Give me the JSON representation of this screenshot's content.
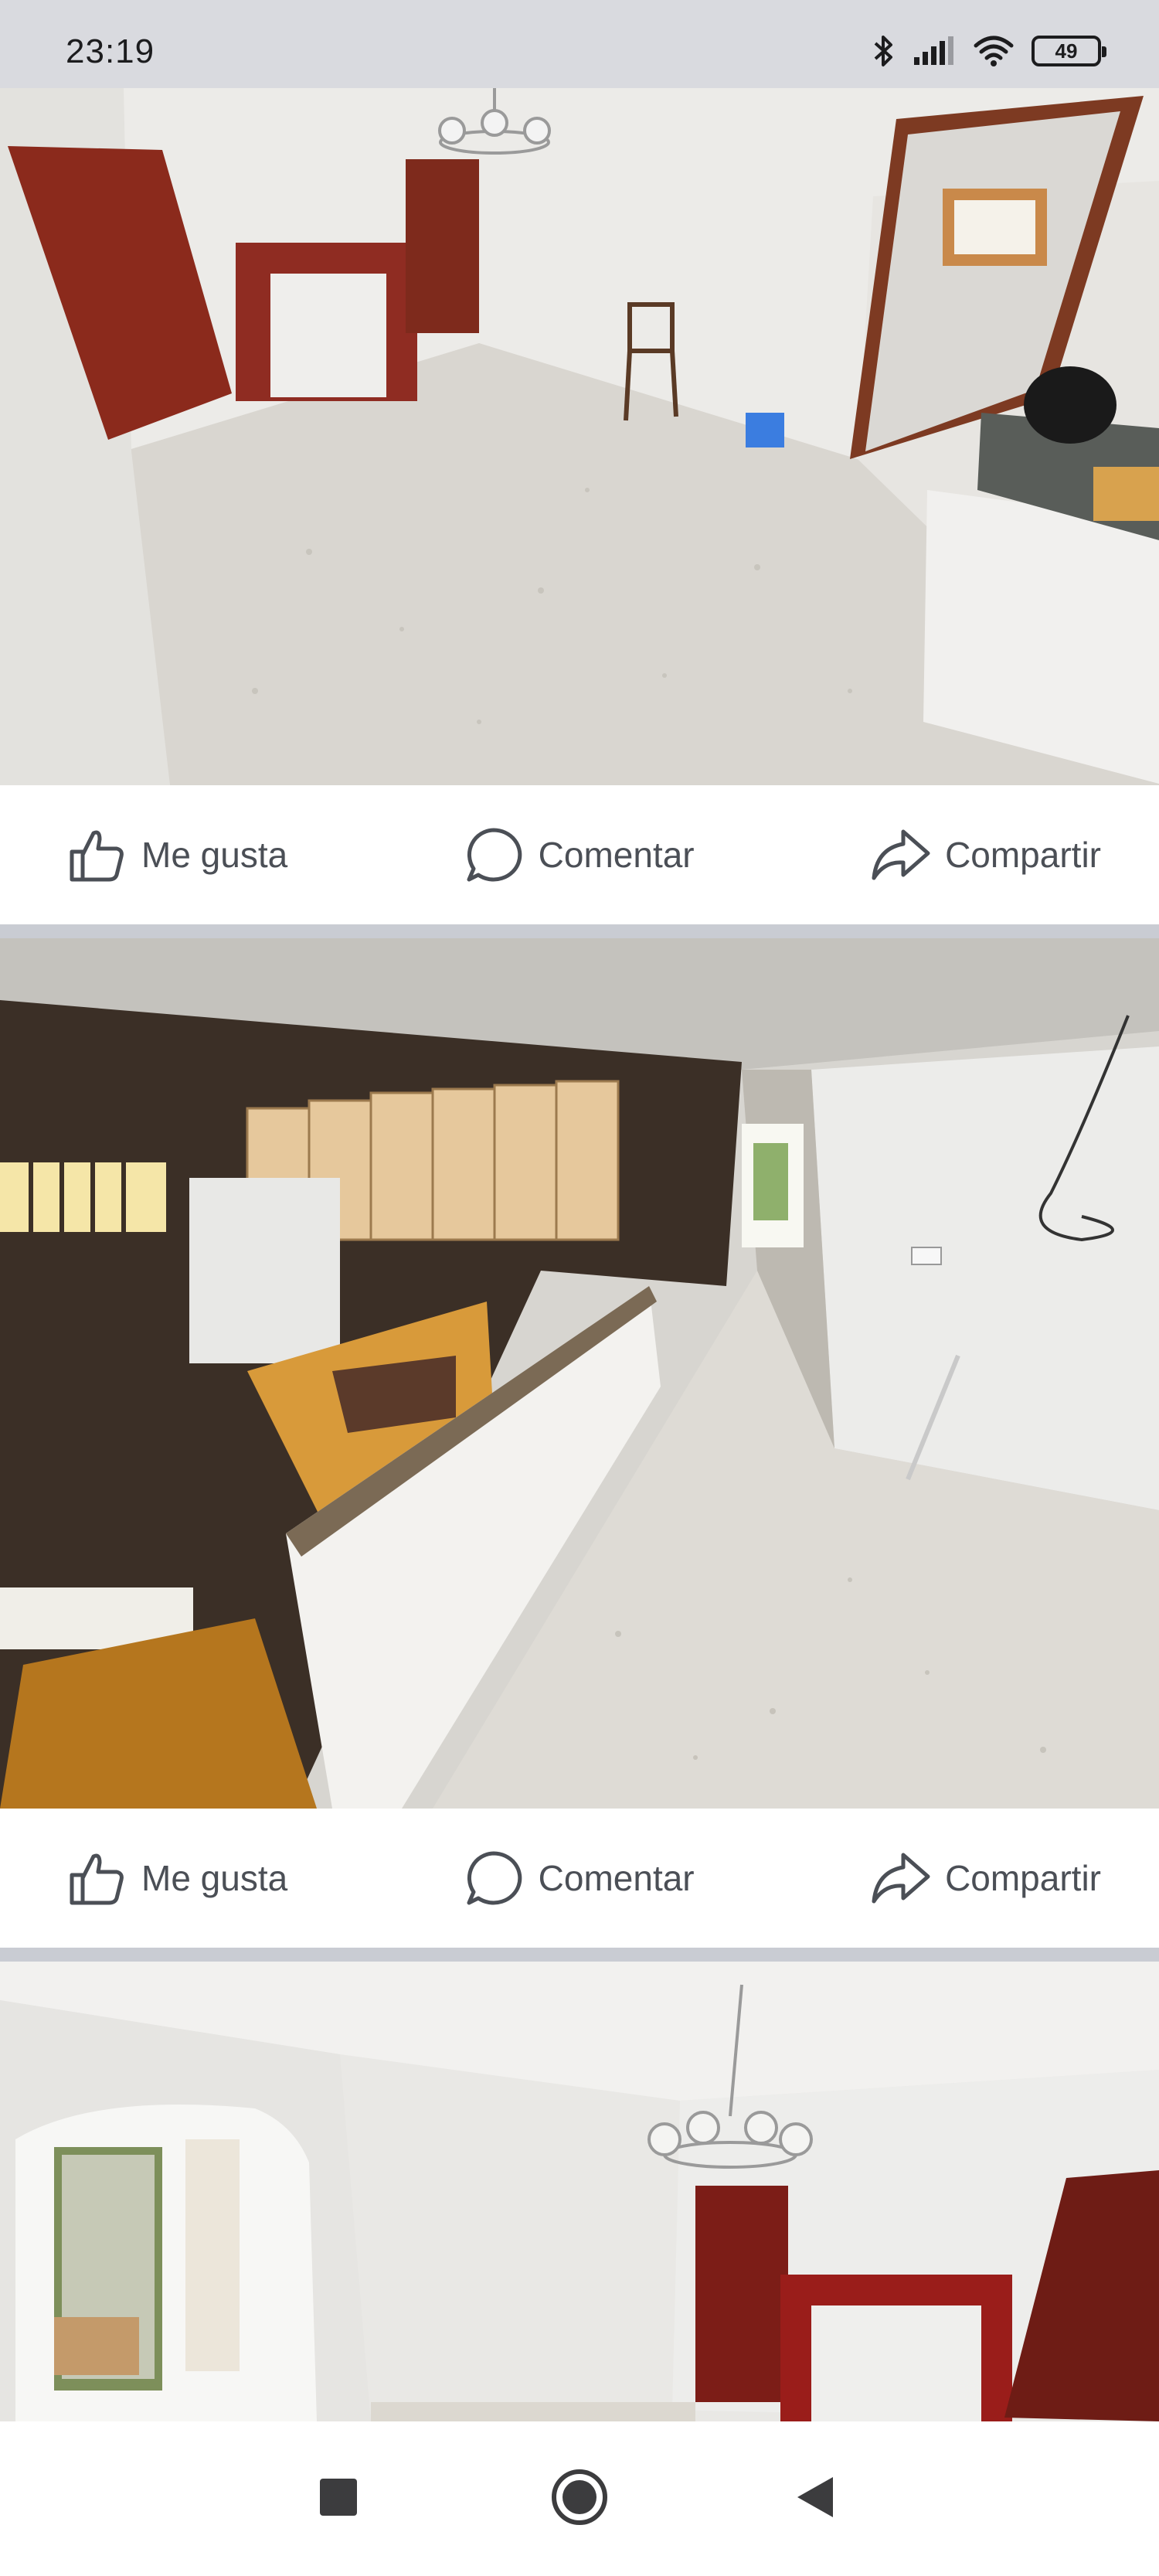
{
  "status_bar": {
    "time": "23:19",
    "battery_level": "49",
    "icons": [
      "bluetooth-icon",
      "signal-icon",
      "wifi-icon",
      "battery-icon"
    ]
  },
  "posts": [
    {
      "image_description_icon": "photo",
      "actions": {
        "like": "Me gusta",
        "comment": "Comentar",
        "share": "Compartir"
      }
    },
    {
      "image_description_icon": "photo",
      "actions": {
        "like": "Me gusta",
        "comment": "Comentar",
        "share": "Compartir"
      }
    },
    {
      "image_description_icon": "photo"
    }
  ],
  "nav_bar": {
    "buttons": [
      "recents-icon",
      "home-icon",
      "back-icon"
    ]
  },
  "colors": {
    "status_bar_bg": "#d9dadf",
    "action_text": "#4b4f56",
    "divider": "#c9ccd3"
  }
}
